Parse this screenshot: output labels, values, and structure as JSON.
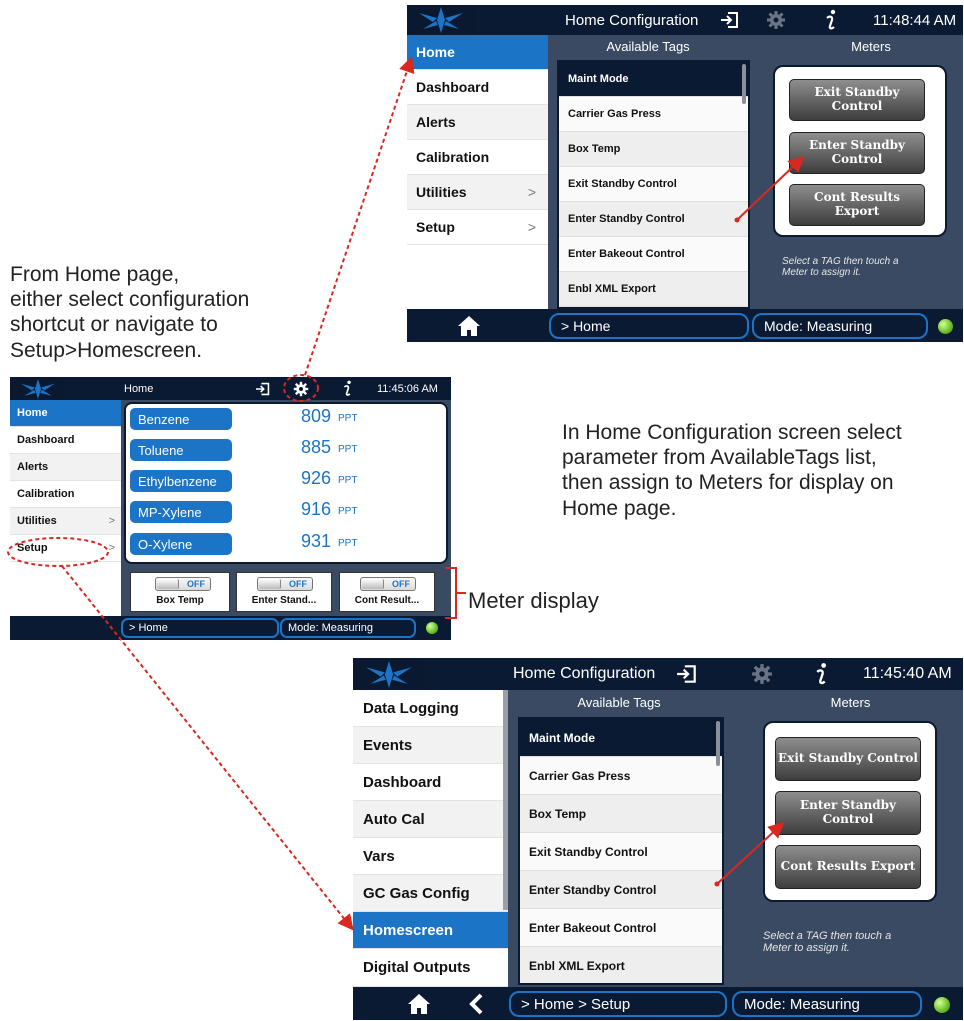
{
  "annotations": {
    "left_note": [
      "From Home page,",
      "either select configuration",
      "shortcut or navigate to",
      "Setup>Homescreen."
    ],
    "right_note": [
      "In Home Configuration screen select",
      "parameter from AvailableTags list,",
      "then assign to Meters for display on",
      "Home page."
    ],
    "meter_display_label": "Meter display"
  },
  "screen_top": {
    "title": "Home Configuration",
    "time": "11:48:44 AM",
    "sidebar": [
      {
        "label": "Home",
        "chevron": ""
      },
      {
        "label": "Dashboard",
        "chevron": ""
      },
      {
        "label": "Alerts",
        "chevron": ""
      },
      {
        "label": "Calibration",
        "chevron": ""
      },
      {
        "label": "Utilities",
        "chevron": ">"
      },
      {
        "label": "Setup",
        "chevron": ">"
      }
    ],
    "available_tags_header": "Available Tags",
    "meters_header": "Meters",
    "tags": [
      "Maint Mode",
      "Carrier Gas Press",
      "Box Temp",
      "Exit Standby Control",
      "Enter Standby Control",
      "Enter Bakeout Control",
      "Enbl XML Export"
    ],
    "meters": [
      "Exit Standby Control",
      "Enter Standby\nControl",
      "Cont Results Export"
    ],
    "hint": "Select a TAG then touch a\nMeter to assign it.",
    "breadcrumb": "> Home",
    "mode": "Mode: Measuring"
  },
  "screen_home": {
    "title": "Home",
    "time": "11:45:06 AM",
    "sidebar": [
      {
        "label": "Home",
        "chevron": ""
      },
      {
        "label": "Dashboard",
        "chevron": ""
      },
      {
        "label": "Alerts",
        "chevron": ""
      },
      {
        "label": "Calibration",
        "chevron": ""
      },
      {
        "label": "Utilities",
        "chevron": ">"
      },
      {
        "label": "Setup",
        "chevron": ">"
      }
    ],
    "parameters": [
      {
        "name": "Benzene",
        "value": "809",
        "unit": "PPT"
      },
      {
        "name": "Toluene",
        "value": "885",
        "unit": "PPT"
      },
      {
        "name": "Ethylbenzene",
        "value": "926",
        "unit": "PPT"
      },
      {
        "name": "MP-Xylene",
        "value": "916",
        "unit": "PPT"
      },
      {
        "name": "O-Xylene",
        "value": "931",
        "unit": "PPT"
      }
    ],
    "meters": [
      {
        "toggle": "OFF",
        "label": "Box Temp"
      },
      {
        "toggle": "OFF",
        "label": "Enter Stand..."
      },
      {
        "toggle": "OFF",
        "label": "Cont Result..."
      }
    ],
    "breadcrumb": "> Home",
    "mode": "Mode: Measuring"
  },
  "screen_bottom": {
    "title": "Home Configuration",
    "time": "11:45:40 AM",
    "sidebar": [
      {
        "label": "Data Logging",
        "chevron": ""
      },
      {
        "label": "Events",
        "chevron": ""
      },
      {
        "label": "Dashboard",
        "chevron": ""
      },
      {
        "label": "Auto Cal",
        "chevron": ""
      },
      {
        "label": "Vars",
        "chevron": ""
      },
      {
        "label": "GC Gas Config",
        "chevron": ""
      },
      {
        "label": "Homescreen",
        "chevron": ""
      },
      {
        "label": "Digital Outputs",
        "chevron": ""
      }
    ],
    "available_tags_header": "Available Tags",
    "meters_header": "Meters",
    "tags": [
      "Maint Mode",
      "Carrier Gas Press",
      "Box Temp",
      "Exit Standby Control",
      "Enter Standby Control",
      "Enter Bakeout Control",
      "Enbl XML Export"
    ],
    "meters": [
      "Exit Standby Control",
      "Enter Standby\nControl",
      "Cont Results Export"
    ],
    "hint": "Select a TAG then touch a\nMeter to assign it.",
    "breadcrumb": "> Home > Setup",
    "mode": "Mode: Measuring"
  },
  "colors": {
    "accent_blue": "#1c74c6",
    "navy": "#0b1a33",
    "arrow_red": "#d9281f",
    "status_green": "#6ec32a"
  },
  "icons": [
    "logo-icon",
    "exit-icon",
    "gear-icon",
    "info-icon",
    "home-icon",
    "back-icon",
    "status-led-icon"
  ]
}
